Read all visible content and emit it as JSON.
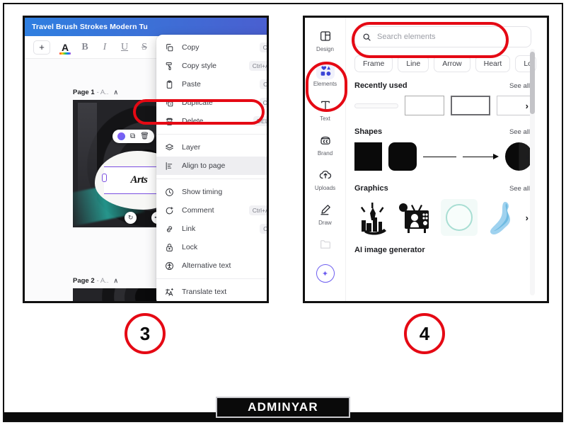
{
  "annotations": {
    "step_left": "3",
    "step_right": "4",
    "highlight_color": "#e50914"
  },
  "watermark": {
    "text": "ADMINYAR"
  },
  "panel3": {
    "titlebar": {
      "title": "Travel Brush Strokes Modern Tu"
    },
    "toolbar": {
      "add_label": "+",
      "font_color_label": "A",
      "bold_label": "B",
      "italic_label": "I",
      "underline_label": "U",
      "strikethrough_label": "S"
    },
    "canvas": {
      "page1_label": "Page 1",
      "page1_sub": "- A..",
      "page2_label": "Page 2",
      "page2_sub": "- A..",
      "chevron": "∧",
      "artwork_text": "Arts"
    },
    "context_menu": {
      "items": [
        {
          "label": "Copy",
          "shortcut": "Ctrl+C",
          "icon": "copy-icon",
          "arrow": "",
          "highlighted": false
        },
        {
          "label": "Copy style",
          "shortcut": "Ctrl+Alt+C",
          "icon": "copy-style-icon",
          "arrow": "",
          "highlighted": false
        },
        {
          "label": "Paste",
          "shortcut": "Ctrl+V",
          "icon": "paste-icon",
          "arrow": "",
          "highlighted": false
        },
        {
          "label": "Duplicate",
          "shortcut": "Ctrl+D",
          "icon": "duplicate-icon",
          "arrow": "",
          "highlighted": false
        },
        {
          "label": "Delete",
          "shortcut": "DELETE",
          "icon": "trash-icon",
          "arrow": "",
          "highlighted": false
        },
        {
          "label": "Layer",
          "shortcut": "",
          "icon": "layers-icon",
          "arrow": "›",
          "highlighted": false
        },
        {
          "label": "Align to page",
          "shortcut": "",
          "icon": "align-icon",
          "arrow": "›",
          "highlighted": true
        },
        {
          "label": "Show timing",
          "shortcut": "",
          "icon": "clock-icon",
          "arrow": "",
          "highlighted": false
        },
        {
          "label": "Comment",
          "shortcut": "Ctrl+Alt+N",
          "icon": "comment-icon",
          "arrow": "",
          "highlighted": false
        },
        {
          "label": "Link",
          "shortcut": "Ctrl+K",
          "icon": "link-icon",
          "arrow": "",
          "highlighted": false
        },
        {
          "label": "Lock",
          "shortcut": "",
          "icon": "lock-icon",
          "arrow": "",
          "highlighted": false
        },
        {
          "label": "Alternative text",
          "shortcut": "",
          "icon": "accessibility-icon",
          "arrow": "",
          "highlighted": false
        },
        {
          "label": "Translate text",
          "shortcut": "",
          "icon": "translate-icon",
          "arrow": "",
          "highlighted": false
        }
      ]
    }
  },
  "panel4": {
    "rail": [
      {
        "label": "Design",
        "icon": "design-icon",
        "active": false
      },
      {
        "label": "Elements",
        "icon": "elements-icon",
        "active": true
      },
      {
        "label": "Text",
        "icon": "text-icon",
        "active": false
      },
      {
        "label": "Brand",
        "icon": "brand-icon",
        "active": false
      },
      {
        "label": "Uploads",
        "icon": "uploads-icon",
        "active": false
      },
      {
        "label": "Draw",
        "icon": "draw-icon",
        "active": false
      },
      {
        "label": "",
        "icon": "projects-icon",
        "active": false
      }
    ],
    "search": {
      "placeholder": "Search elements",
      "icon": "search-icon"
    },
    "chips": [
      "Frame",
      "Line",
      "Arrow",
      "Heart",
      "Lo"
    ],
    "sections": [
      {
        "title": "Recently used",
        "see_all": "See all"
      },
      {
        "title": "Shapes",
        "see_all": "See all"
      },
      {
        "title": "Graphics",
        "see_all": "See all"
      },
      {
        "title": "AI image generator",
        "see_all": ""
      }
    ],
    "next_arrow": "›"
  }
}
